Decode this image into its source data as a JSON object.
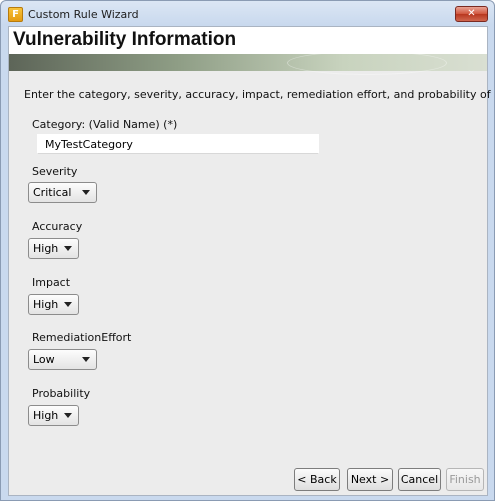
{
  "window": {
    "title": "Custom Rule Wizard",
    "app_icon_glyph": "F",
    "close_glyph": "✕"
  },
  "header": {
    "title": "Vulnerability Information"
  },
  "intro_text": "Enter the category, severity, accuracy, impact, remediation effort, and probability of",
  "fields": {
    "category": {
      "label": "Category: (Valid Name) (*)",
      "value": "MyTestCategory"
    },
    "severity": {
      "label": "Severity",
      "value": "Critical"
    },
    "accuracy": {
      "label": "Accuracy",
      "value": "High"
    },
    "impact": {
      "label": "Impact",
      "value": "High"
    },
    "remediation_effort": {
      "label": "RemediationEffort",
      "value": "Low"
    },
    "probability": {
      "label": "Probability",
      "value": "High"
    }
  },
  "buttons": {
    "back": "< Back",
    "next": "Next >",
    "cancel": "Cancel",
    "finish": "Finish"
  },
  "colors": {
    "accent_close": "#d0553d",
    "header_band": "#8e9d85"
  }
}
